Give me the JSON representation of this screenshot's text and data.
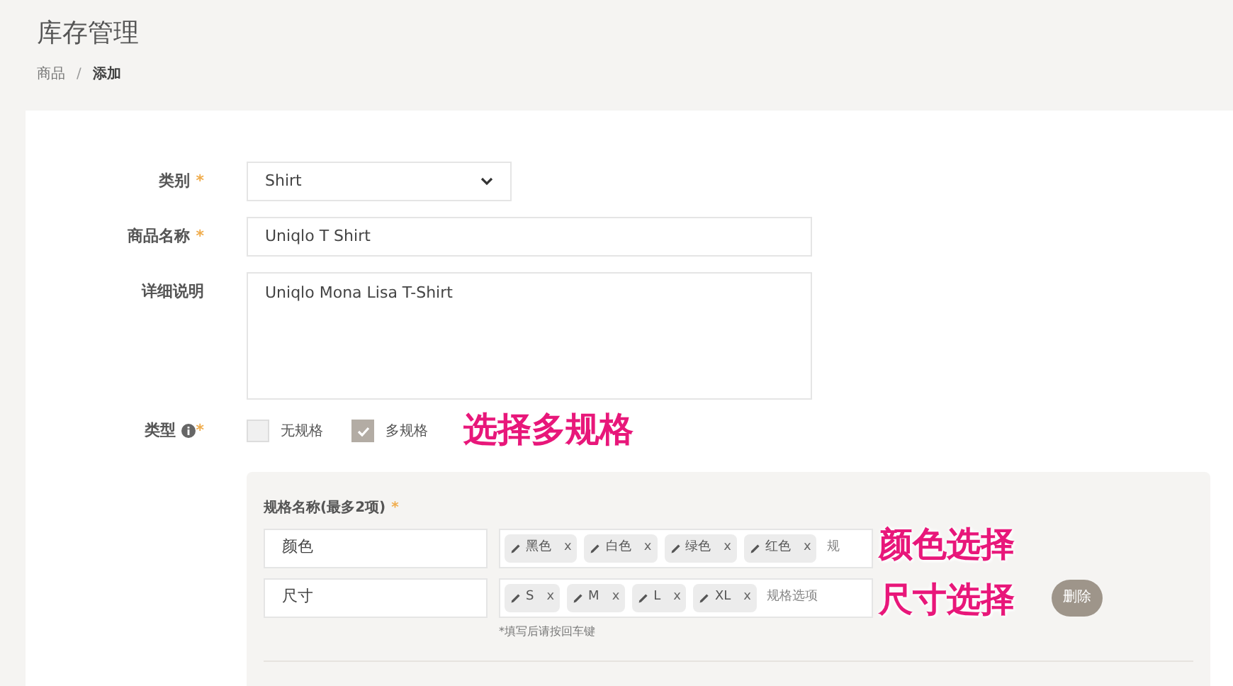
{
  "header": {
    "title": "库存管理",
    "separator": "/",
    "breadcrumb": [
      {
        "label": "商品",
        "current": false
      },
      {
        "label": "添加",
        "current": true
      }
    ]
  },
  "form": {
    "category": {
      "label": "类别",
      "required_mark": "*",
      "value": "Shirt"
    },
    "name": {
      "label": "商品名称",
      "required_mark": "*",
      "value": "Uniqlo T Shirt"
    },
    "description": {
      "label": "详细说明",
      "value": "Uniqlo Mona Lisa T-Shirt"
    },
    "type": {
      "label": "类型",
      "required_mark": "*",
      "options": [
        {
          "label": "无规格",
          "checked": false
        },
        {
          "label": "多规格",
          "checked": true
        }
      ]
    },
    "specs": {
      "label": "规格名称(最多2项)",
      "required_mark": "*",
      "rows": [
        {
          "name": "颜色",
          "tags": [
            {
              "label": "黑色",
              "remove": "x"
            },
            {
              "label": "白色",
              "remove": "x"
            },
            {
              "label": "绿色",
              "remove": "x"
            },
            {
              "label": "红色",
              "remove": "x"
            }
          ],
          "placeholder": "规"
        },
        {
          "name": "尺寸",
          "tags": [
            {
              "label": "S",
              "remove": "x"
            },
            {
              "label": "M",
              "remove": "x"
            },
            {
              "label": "L",
              "remove": "x"
            },
            {
              "label": "XL",
              "remove": "x"
            }
          ],
          "placeholder": "规格选项",
          "delete": "删除"
        }
      ],
      "hint": "*填写后请按回车键"
    }
  },
  "annotations": [
    "选择多规格",
    "颜色选择",
    "尺寸选择"
  ]
}
